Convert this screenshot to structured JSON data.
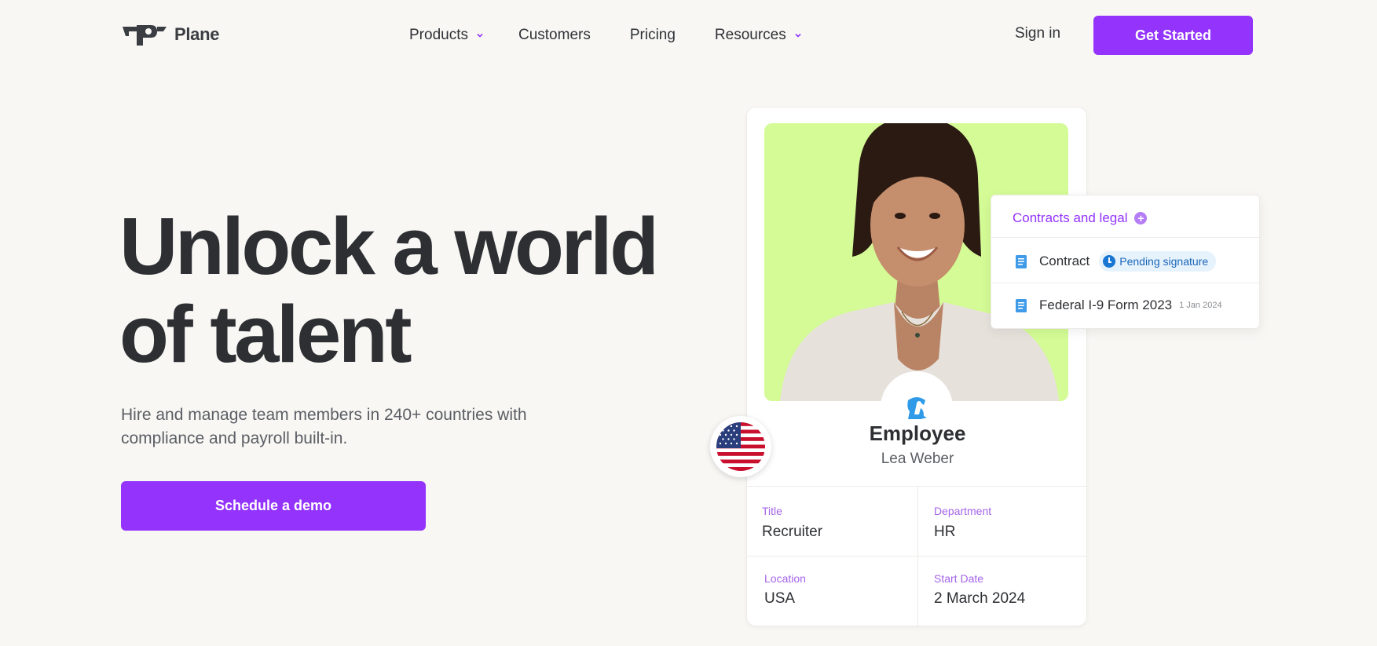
{
  "brand": {
    "name": "Plane",
    "accent": "#9333fc",
    "text": "#2d2f33"
  },
  "nav": {
    "products": "Products",
    "customers": "Customers",
    "pricing": "Pricing",
    "resources": "Resources",
    "sign_in": "Sign in",
    "get_started": "Get Started"
  },
  "hero": {
    "title_line1": "Unlock a world",
    "title_line2": "of talent",
    "subtitle_line1": "Hire and manage team members in 240+ countries with",
    "subtitle_line2": "compliance and payroll built-in.",
    "cta": "Schedule a demo"
  },
  "employee_card": {
    "role": "Employee",
    "name": "Lea Weber",
    "photo_bg": "#d4fb95",
    "fields": {
      "title_label": "Title",
      "title_value": "Recruiter",
      "department_label": "Department",
      "department_value": "HR",
      "location_label": "Location",
      "location_value": "USA",
      "start_label": "Start Date",
      "start_value": "2 March 2024"
    }
  },
  "contracts": {
    "heading": "Contracts and legal",
    "items": [
      {
        "name": "Contract",
        "status": "Pending signature",
        "icon": "document-icon"
      },
      {
        "name": "Federal I-9 Form 2023",
        "date": "1 Jan 2024",
        "icon": "document-icon"
      }
    ]
  }
}
